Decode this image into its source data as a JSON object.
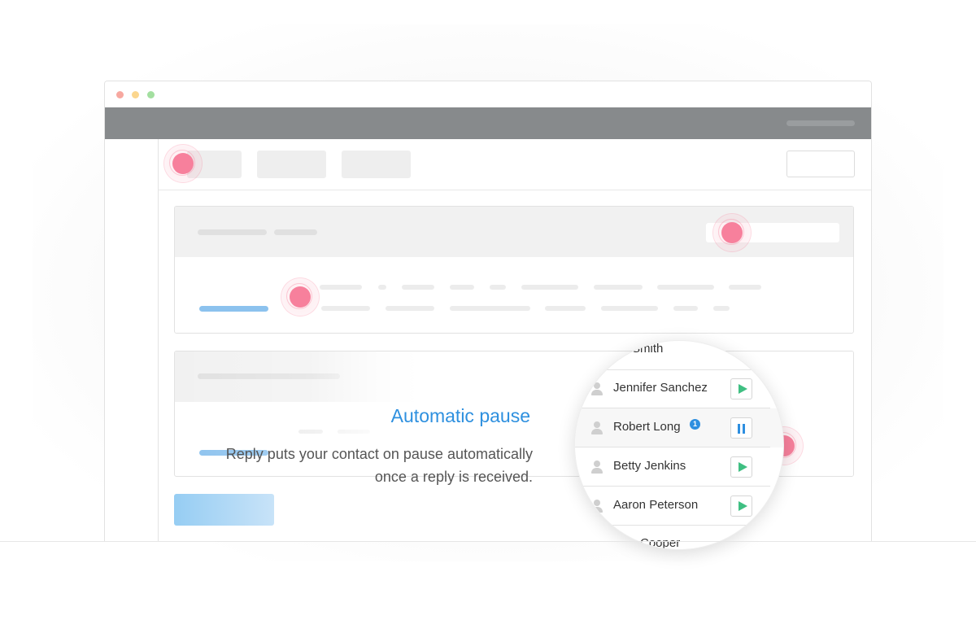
{
  "feature": {
    "title": "Automatic pause",
    "description": "Reply puts your contact on pause automatically once a reply is received."
  },
  "colors": {
    "accent": "#2e90df",
    "marker": "#f7809c",
    "play": "#3fbf82",
    "pause": "#2e8fe0",
    "topbar": "#878a8c"
  },
  "contacts": [
    {
      "name": "Smith",
      "status": "partial"
    },
    {
      "name": "Jennifer Sanchez",
      "action": "play-icon"
    },
    {
      "name": "Robert Long",
      "badge": "1",
      "action": "pause-icon"
    },
    {
      "name": "Betty Jenkins",
      "action": "play-icon"
    },
    {
      "name": "Aaron Peterson",
      "action": "play-icon"
    },
    {
      "name": "Cooper",
      "status": "partial"
    }
  ]
}
